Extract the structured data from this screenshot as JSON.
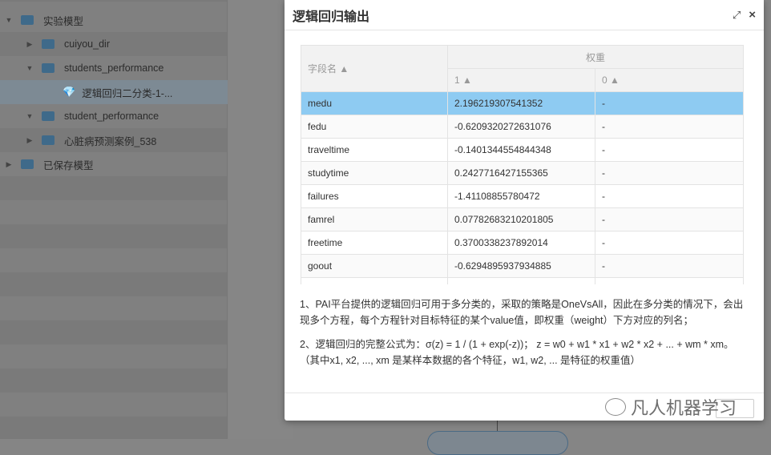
{
  "tree": [
    {
      "label": "实验模型",
      "level": 0,
      "expanded": true,
      "icon": "folder-open-icon"
    },
    {
      "label": "cuiyou_dir",
      "level": 1,
      "expanded": false,
      "icon": "folder-icon"
    },
    {
      "label": "students_performance",
      "level": 1,
      "expanded": true,
      "icon": "folder-open-icon"
    },
    {
      "label": "逻辑回归二分类-1-...",
      "level": 2,
      "selected": true,
      "icon": "model-gem-icon"
    },
    {
      "label": "student_performance",
      "level": 1,
      "expanded": true,
      "icon": "folder-open-icon"
    },
    {
      "label": "心脏病预测案例_538",
      "level": 1,
      "expanded": false,
      "icon": "folder-icon"
    },
    {
      "label": "已保存模型",
      "level": 0,
      "expanded": false,
      "icon": "folder-icon"
    }
  ],
  "modal": {
    "title": "逻辑回归输出",
    "table": {
      "field_header": "字段名 ▲",
      "group_header": "权重",
      "col1": "1 ▲",
      "col0": "0 ▲",
      "rows": [
        [
          "medu",
          "2.196219307541352",
          "-"
        ],
        [
          "fedu",
          "-0.6209320272631076",
          "-"
        ],
        [
          "traveltime",
          "-0.1401344554844348",
          "-"
        ],
        [
          "studytime",
          "0.2427716427155365",
          "-"
        ],
        [
          "failures",
          "-1.41108855780472",
          "-"
        ],
        [
          "famrel",
          "0.07782683210201805",
          "-"
        ],
        [
          "freetime",
          "0.3700338237892014",
          "-"
        ],
        [
          "goout",
          "-0.6294895937934885",
          "-"
        ]
      ]
    },
    "note1": "1、PAI平台提供的逻辑回归可用于多分类的，采取的策略是OneVsAll，因此在多分类的情况下，会出现多个方程，每个方程针对目标特征的某个value值，即权重（weight）下方对应的列名；",
    "note2": "2、逻辑回归的完整公式为：σ(z) = 1 / (1 + exp(-z))；  z = w0 + w1 * x1 + w2 * x2 + ... + wm * xm。（其中x1, x2, ..., xm 是某样本数据的各个特征，w1, w2, ... 是特征的权重值）"
  },
  "watermark": "凡人机器学习",
  "colors": {
    "selected_row": "#8ecbf2",
    "folder": "#3f6a8a"
  }
}
